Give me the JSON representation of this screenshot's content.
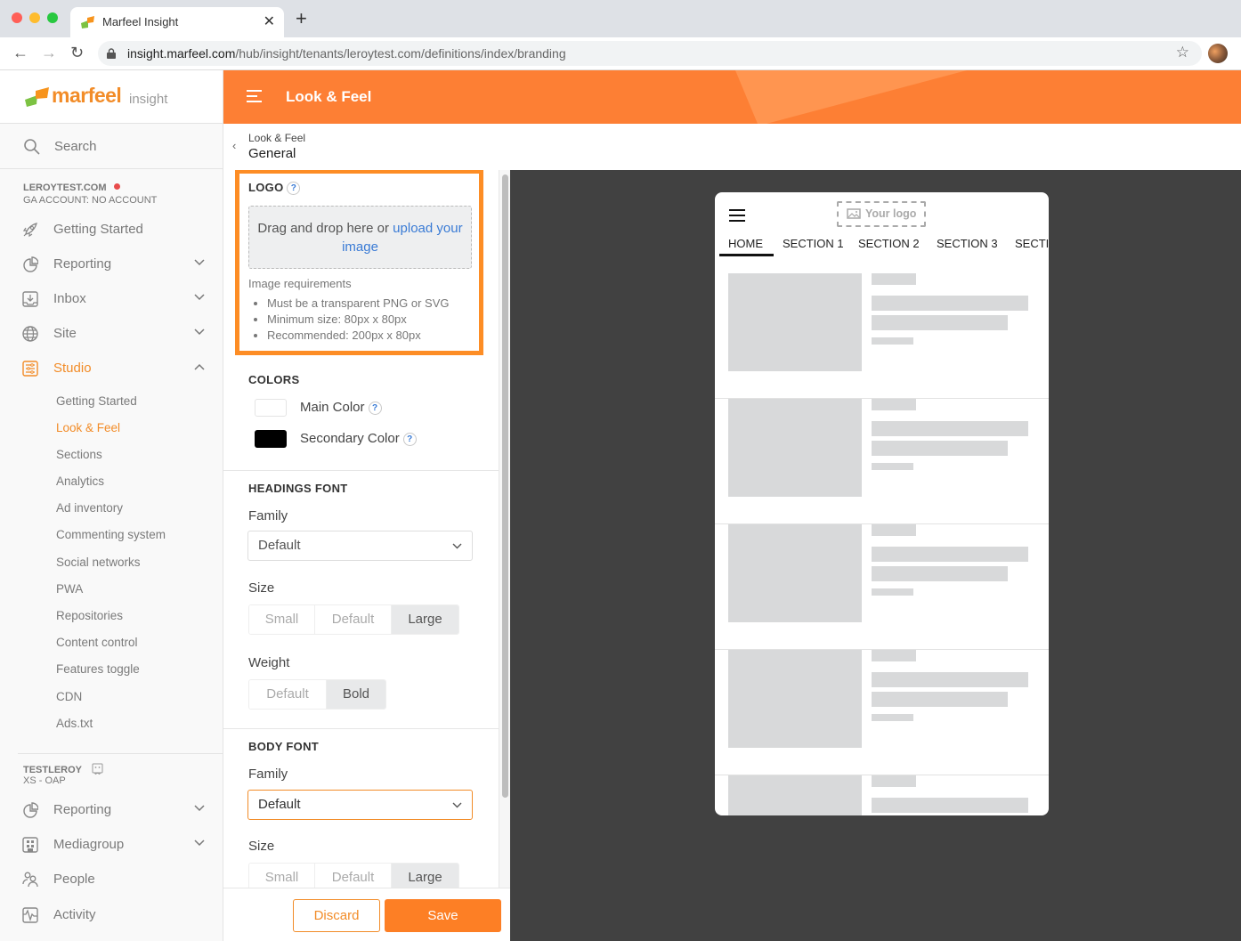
{
  "browser": {
    "tab_title": "Marfeel Insight",
    "url_host": "insight.marfeel.com",
    "url_path": "/hub/insight/tenants/leroytest.com/definitions/index/branding",
    "icons": {
      "back": "arrow-left-icon",
      "forward": "arrow-right-icon",
      "reload": "reload-icon",
      "lock": "lock-icon",
      "bookmark": "star-icon",
      "close_tab": "close-icon",
      "new_tab": "plus-icon"
    }
  },
  "sidebar": {
    "brand_name": "marfeel",
    "brand_sub": "insight",
    "search_label": "Search",
    "account": {
      "name": "LEROYTEST.COM",
      "ga": "GA ACCOUNT: NO ACCOUNT",
      "status_color": "#e84c4c"
    },
    "items": [
      {
        "label": "Getting Started",
        "icon": "rocket-icon",
        "chevron": false
      },
      {
        "label": "Reporting",
        "icon": "pie-chart-icon",
        "chevron": "down"
      },
      {
        "label": "Inbox",
        "icon": "inbox-icon",
        "chevron": "down"
      },
      {
        "label": "Site",
        "icon": "globe-icon",
        "chevron": "down"
      },
      {
        "label": "Studio",
        "icon": "sliders-icon",
        "chevron": "up",
        "active": true
      }
    ],
    "studio_items": [
      {
        "label": "Getting Started"
      },
      {
        "label": "Look & Feel",
        "active": true
      },
      {
        "label": "Sections"
      },
      {
        "label": "Analytics"
      },
      {
        "label": "Ad inventory"
      },
      {
        "label": "Commenting system"
      },
      {
        "label": "Social networks"
      },
      {
        "label": "PWA"
      },
      {
        "label": "Repositories"
      },
      {
        "label": "Content control"
      },
      {
        "label": "Features toggle"
      },
      {
        "label": "CDN"
      },
      {
        "label": "Ads.txt"
      }
    ],
    "group": {
      "name": "TESTLEROY",
      "sub": "XS - OAP"
    },
    "group_items": [
      {
        "label": "Reporting",
        "icon": "pie-chart-icon",
        "chevron": "down"
      },
      {
        "label": "Mediagroup",
        "icon": "building-icon",
        "chevron": "down"
      },
      {
        "label": "People",
        "icon": "people-icon",
        "chevron": false
      },
      {
        "label": "Activity",
        "icon": "activity-icon",
        "chevron": false
      }
    ]
  },
  "header": {
    "title": "Look & Feel",
    "accent": "#fd7f34"
  },
  "breadcrumb": {
    "parent": "Look & Feel",
    "current": "General"
  },
  "logo_section": {
    "title": "LOGO",
    "drop_text": "Drag and drop here or ",
    "upload_link": "upload your image",
    "req_title": "Image requirements",
    "requirements": [
      "Must be a transparent PNG or SVG",
      "Minimum size: 80px x 80px",
      "Recommended: 200px x 80px"
    ]
  },
  "colors_section": {
    "title": "COLORS",
    "main_label": "Main Color",
    "main_value": "#ffffff",
    "secondary_label": "Secondary Color",
    "secondary_value": "#000000"
  },
  "headings_font": {
    "title": "HEADINGS FONT",
    "family_label": "Family",
    "family_value": "Default",
    "size_label": "Size",
    "size_options": [
      "Small",
      "Default",
      "Large"
    ],
    "size_selected": "Large",
    "weight_label": "Weight",
    "weight_options": [
      "Default",
      "Bold"
    ],
    "weight_selected": "Bold"
  },
  "body_font": {
    "title": "BODY FONT",
    "family_label": "Family",
    "family_value": "Default",
    "size_label": "Size",
    "size_options": [
      "Small",
      "Default",
      "Large"
    ],
    "size_selected": "Large"
  },
  "footer": {
    "discard": "Discard",
    "save": "Save"
  },
  "preview": {
    "logo_placeholder": "Your logo",
    "nav": [
      "HOME",
      "SECTION 1",
      "SECTION 2",
      "SECTION 3",
      "SECTI"
    ],
    "active_nav": "HOME",
    "card_count": 5
  }
}
